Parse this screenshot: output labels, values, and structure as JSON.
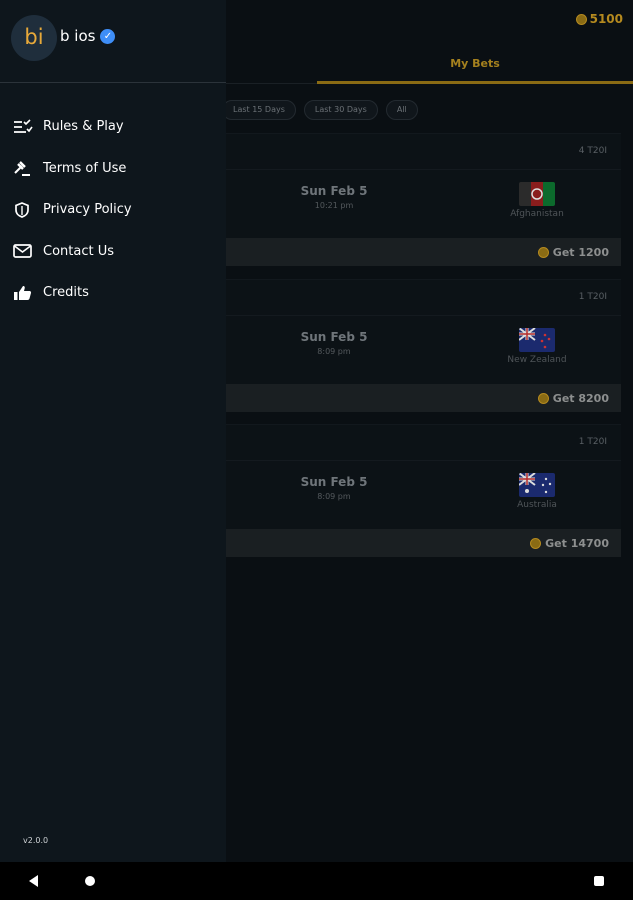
{
  "header": {
    "coin_balance": "5100"
  },
  "tabs": {
    "active_label": "My Bets"
  },
  "filters": [
    {
      "label": "Last 15 Days"
    },
    {
      "label": "Last 30 Days"
    },
    {
      "label": "All"
    }
  ],
  "bets": [
    {
      "format": "4 T20I",
      "date": "Sun Feb 5",
      "time": "10:21 pm",
      "team": "Afghanistan",
      "payout": "Get 1200"
    },
    {
      "format": "1 T20I",
      "date": "Sun Feb 5",
      "time": "8:09 pm",
      "team": "New Zealand",
      "payout": "Get 8200"
    },
    {
      "format": "1 T20I",
      "date": "Sun Feb 5",
      "time": "8:09 pm",
      "team": "Australia",
      "payout": "Get 14700"
    }
  ],
  "drawer": {
    "avatar_text": "bi",
    "username": "b ios",
    "menu": [
      {
        "label": "Rules & Play",
        "icon": "checklist-icon"
      },
      {
        "label": "Terms of Use",
        "icon": "gavel-icon"
      },
      {
        "label": "Privacy Policy",
        "icon": "shield-icon"
      },
      {
        "label": "Contact Us",
        "icon": "mail-icon"
      },
      {
        "label": "Credits",
        "icon": "thumbs-up-icon"
      }
    ],
    "version": "v2.0.0"
  },
  "colors": {
    "accent": "#b58a1f",
    "drawer_bg": "#0e161c",
    "verified": "#3e8ef7"
  }
}
